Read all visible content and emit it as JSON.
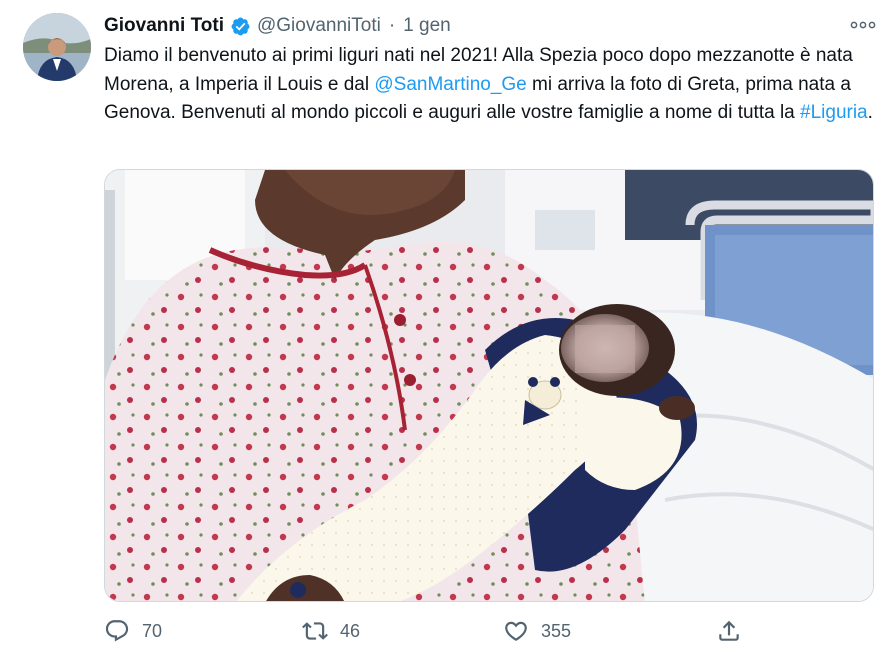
{
  "author": {
    "name": "Giovanni Toti",
    "handle": "@GiovanniToti",
    "time": "1 gen",
    "separator": "·",
    "verified_icon": "verified-badge-icon"
  },
  "tweet": {
    "text_before_mention": "Diamo il benvenuto ai primi liguri nati nel 2021! Alla Spezia poco dopo mezzanotte è nata Morena, a Imperia il Louis e dal ",
    "mention": "@SanMartino_Ge",
    "text_between": " mi arriva la foto di Greta, prima nata a Genova. Benvenuti al mondo piccoli e auguri alle vostre famiglie a nome di tutta la ",
    "hashtag": "#Liguria",
    "text_after": "."
  },
  "metrics": {
    "replies": "70",
    "retweets": "46",
    "likes": "355"
  },
  "colors": {
    "link": "#1d9bf0",
    "verified": "#1d9bf0",
    "muted": "#536471",
    "text": "#0f1419"
  },
  "icons": {
    "more": "more-icon",
    "reply": "reply-icon",
    "retweet": "retweet-icon",
    "like": "like-icon",
    "share": "share-icon"
  }
}
